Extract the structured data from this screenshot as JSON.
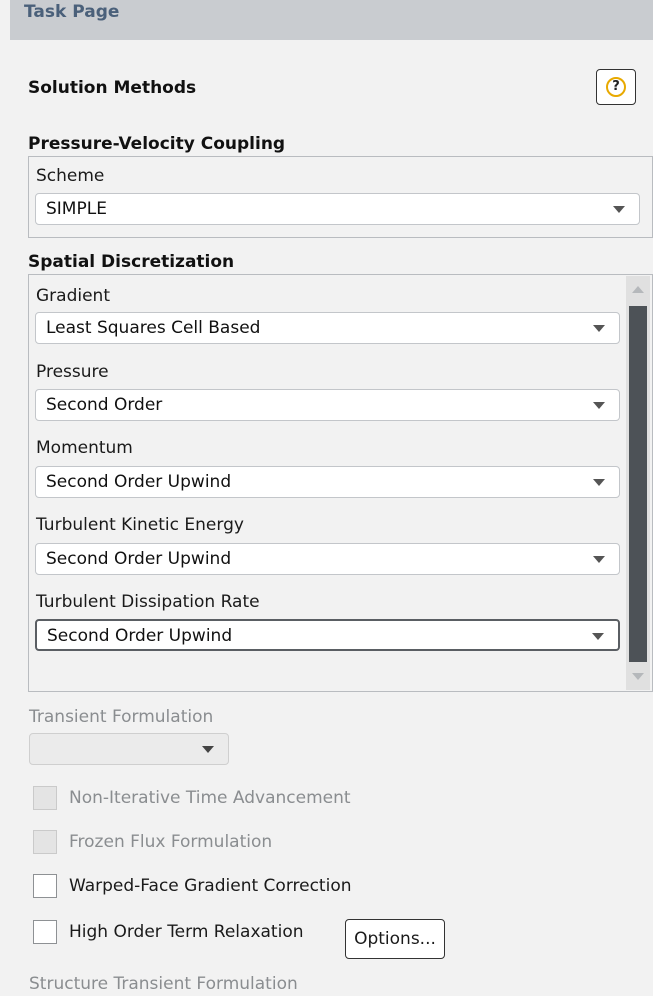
{
  "header": {
    "title": "Task Page"
  },
  "panel": {
    "title": "Solution Methods",
    "help_label": "?"
  },
  "pressure_velocity": {
    "group_title": "Pressure-Velocity Coupling",
    "scheme_label": "Scheme",
    "scheme_value": "SIMPLE"
  },
  "spatial": {
    "group_title": "Spatial Discretization",
    "fields": [
      {
        "label": "Gradient",
        "value": "Least Squares Cell Based"
      },
      {
        "label": "Pressure",
        "value": "Second Order"
      },
      {
        "label": "Momentum",
        "value": "Second Order Upwind"
      },
      {
        "label": "Turbulent Kinetic Energy",
        "value": "Second Order Upwind"
      },
      {
        "label": "Turbulent Dissipation Rate",
        "value": "Second Order Upwind"
      }
    ]
  },
  "transient": {
    "label": "Transient Formulation",
    "value": ""
  },
  "checkboxes": [
    {
      "label": "Non-Iterative Time Advancement",
      "checked": false,
      "enabled": false
    },
    {
      "label": "Frozen Flux Formulation",
      "checked": false,
      "enabled": false
    },
    {
      "label": "Warped-Face Gradient Correction",
      "checked": false,
      "enabled": true
    },
    {
      "label": "High Order Term Relaxation",
      "checked": false,
      "enabled": true
    }
  ],
  "options_button": {
    "label": "Options..."
  },
  "structure_transient": {
    "label": "Structure Transient Formulation"
  }
}
